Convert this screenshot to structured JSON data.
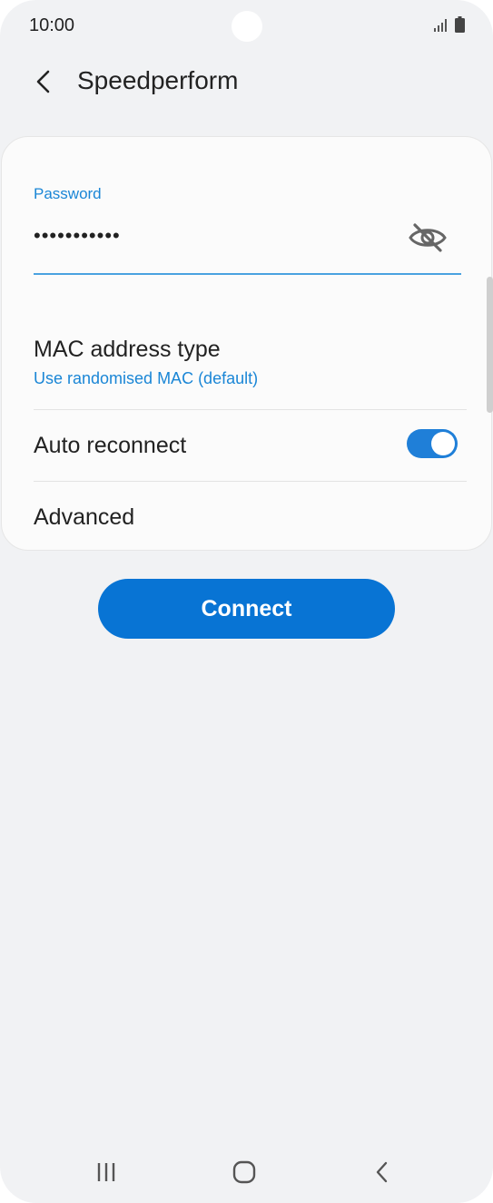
{
  "status_bar": {
    "time": "10:00",
    "icons": [
      "signal-icon",
      "battery-icon"
    ]
  },
  "header": {
    "title": "Speedperform",
    "back_icon": "chevron-left-icon"
  },
  "password": {
    "label": "Password",
    "value": "•••••••••••",
    "visibility_icon": "eye-off-icon"
  },
  "settings": {
    "mac_title": "MAC address type",
    "mac_value": "Use randomised MAC (default)",
    "auto_reconnect_label": "Auto reconnect",
    "auto_reconnect_on": true,
    "advanced_label": "Advanced"
  },
  "connect_label": "Connect",
  "nav": {
    "recents_icon": "recents-icon",
    "home_icon": "home-icon",
    "back_icon": "back-icon"
  },
  "colors": {
    "accent": "#1a86d6",
    "button": "#0874d4",
    "background": "#f1f2f4"
  }
}
